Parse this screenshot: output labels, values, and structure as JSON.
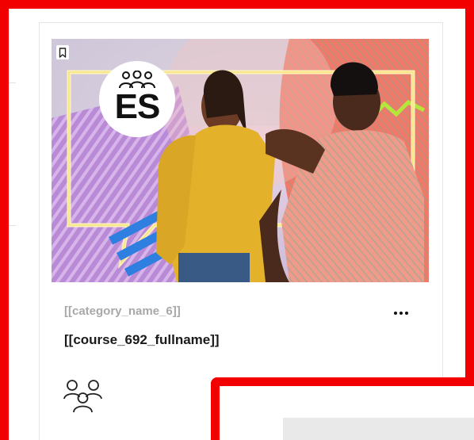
{
  "card": {
    "category_name": "[[category_name_6]]",
    "course_fullname": "[[course_692_fullname]]",
    "language_code": "ES",
    "icons": {
      "bookmark": "bookmark-icon",
      "group": "group-icon",
      "more": "more-options-icon",
      "participants": "participants-icon"
    }
  },
  "colors": {
    "highlight_border": "#f20000",
    "category_text": "#a8a8a8",
    "title_text": "#1a1a1a"
  }
}
